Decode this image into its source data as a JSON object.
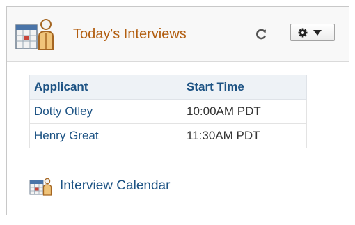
{
  "pagelet": {
    "title": "Today's Interviews",
    "icons": {
      "header": "calendar-person-icon",
      "refresh": "refresh-icon",
      "options": "gear-icon",
      "options_caret": "chevron-down-icon",
      "calendar_link": "calendar-person-icon"
    }
  },
  "table": {
    "headers": [
      "Applicant",
      "Start Time"
    ],
    "rows": [
      {
        "applicant": "Dotty Otley",
        "start_time": "10:00AM PDT"
      },
      {
        "applicant": "Henry Great",
        "start_time": "11:30AM PDT"
      }
    ]
  },
  "links": {
    "interview_calendar": "Interview Calendar"
  },
  "colors": {
    "title": "#b25e10",
    "link": "#1d5384",
    "header_bg": "#eef2f6"
  }
}
